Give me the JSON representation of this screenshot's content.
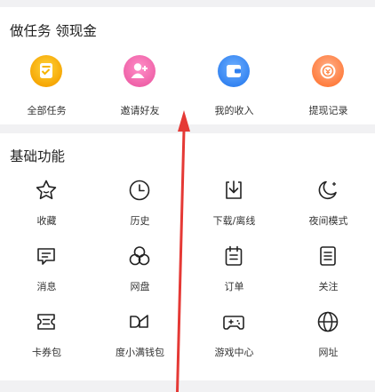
{
  "tasks_section": {
    "title": "做任务  领现金",
    "items": [
      {
        "label": "全部任务",
        "icon": "all-tasks-icon",
        "color": "#f5b400"
      },
      {
        "label": "邀请好友",
        "icon": "invite-friends-icon",
        "color": "#f26fb1"
      },
      {
        "label": "我的收入",
        "icon": "wallet-icon",
        "color": "#3b8df7"
      },
      {
        "label": "提现记录",
        "icon": "withdraw-record-icon",
        "color": "#ff8a4c"
      }
    ]
  },
  "basic_section": {
    "title": "基础功能",
    "items": [
      {
        "label": "收藏",
        "icon": "star-icon"
      },
      {
        "label": "历史",
        "icon": "clock-icon"
      },
      {
        "label": "下载/离线",
        "icon": "download-icon"
      },
      {
        "label": "夜间模式",
        "icon": "moon-icon"
      },
      {
        "label": "消息",
        "icon": "message-icon"
      },
      {
        "label": "网盘",
        "icon": "cloud-drive-icon"
      },
      {
        "label": "订单",
        "icon": "order-icon"
      },
      {
        "label": "关注",
        "icon": "follow-list-icon"
      },
      {
        "label": "卡券包",
        "icon": "coupon-icon"
      },
      {
        "label": "度小满钱包",
        "icon": "dxm-wallet-icon"
      },
      {
        "label": "游戏中心",
        "icon": "gamepad-icon"
      },
      {
        "label": "网址",
        "icon": "globe-icon"
      }
    ]
  },
  "annotation": {
    "arrow_color": "#e53935"
  }
}
